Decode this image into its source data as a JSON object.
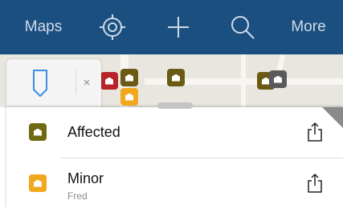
{
  "navbar": {
    "maps_label": "Maps",
    "more_label": "More",
    "icons": [
      "locate-icon",
      "plus-icon",
      "search-icon"
    ]
  },
  "search": {
    "close_symbol": "×"
  },
  "layers": [
    {
      "title": "Affected",
      "subtitle": "",
      "color": "#6f6a12"
    },
    {
      "title": "Minor",
      "subtitle": "Fred",
      "color": "#f2a81d"
    }
  ],
  "colors": {
    "navbar": "#1b4f80",
    "marker_red": "#b8242a",
    "marker_brown": "#6b5a14",
    "marker_orange": "#f2a81d"
  }
}
